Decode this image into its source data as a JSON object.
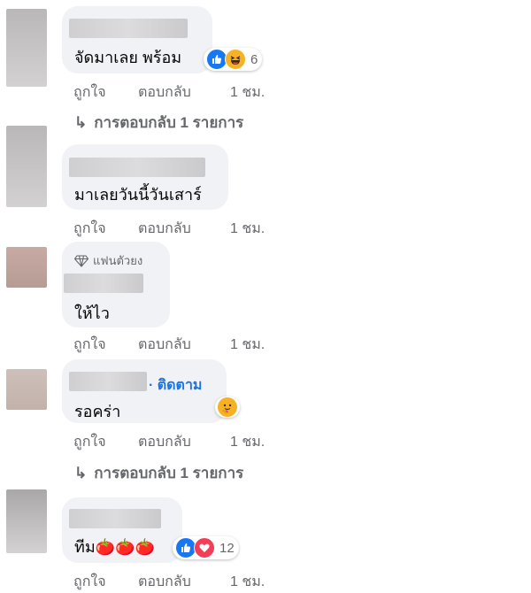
{
  "actions": {
    "like": "ถูกใจ",
    "reply": "ตอบกลับ",
    "time": "1 ชม."
  },
  "replies_label": "การตอบกลับ 1 รายการ",
  "follow_label": "· ติดตาม",
  "fan_badge": "แฟนตัวยง",
  "comments": [
    {
      "text": "จัดมาเลย พร้อม",
      "reactions": [
        "like-icon",
        "haha-icon"
      ],
      "reaction_count": "6"
    },
    {
      "text": "มาเลยวันนี้วันเสาร์"
    },
    {
      "text": "ให้ไว"
    },
    {
      "text": "รอคร่า",
      "reactions": [
        "care-icon"
      ]
    },
    {
      "text": "ทีม🍅🍅🍅",
      "reactions": [
        "like-icon",
        "love-icon"
      ],
      "reaction_count": "12"
    }
  ],
  "colors": {
    "bubble": "#f0f2f5",
    "action_text": "#65676b",
    "link": "#1b74e4",
    "like": "#1877f2",
    "love": "#f33e58",
    "haha": "#f7b125"
  }
}
